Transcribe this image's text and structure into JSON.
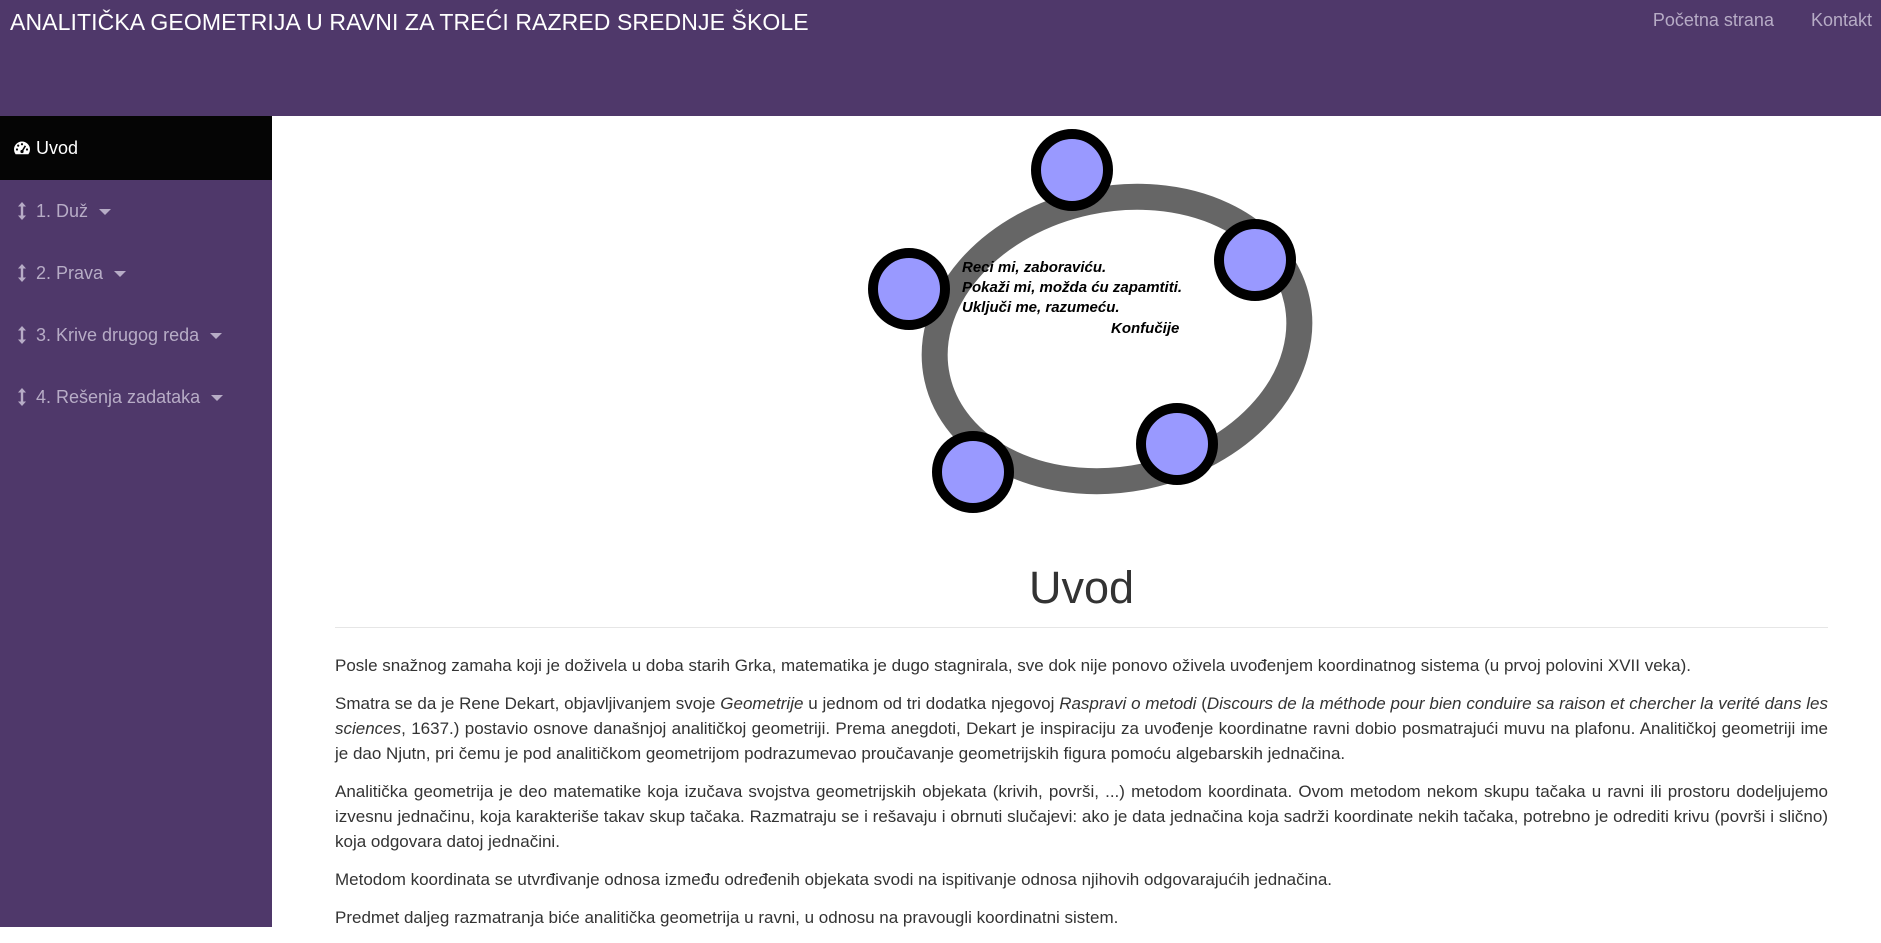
{
  "header": {
    "title": "ANALITIČKA GEOMETRIJA U RAVNI ZA TREĆI RAZRED SREDNJE ŠKOLE",
    "nav": [
      {
        "label": "Početna strana"
      },
      {
        "label": "Kontakt"
      }
    ],
    "background_color": "#4f386a",
    "nav_color": "#b7acc6"
  },
  "sidebar": {
    "background_color": "#4f386a",
    "active_background_color": "#050505",
    "items": [
      {
        "label": "Uvod",
        "icon": "dashboard-icon",
        "active": true
      },
      {
        "label": "1. Duž",
        "icon": "vertical-arrows-icon",
        "has_dropdown": true
      },
      {
        "label": "2. Prava",
        "icon": "vertical-arrows-icon",
        "has_dropdown": true
      },
      {
        "label": "3. Krive drugog reda",
        "icon": "vertical-arrows-icon",
        "has_dropdown": true
      },
      {
        "label": "4. Rešenja zadataka",
        "icon": "vertical-arrows-icon",
        "has_dropdown": true
      }
    ]
  },
  "logo": {
    "quote": [
      "Reci mi, zaboraviću.",
      "Pokaži mi, možda ću zapamtiti.",
      "Uključi me, razumeću.",
      "Konfučije"
    ],
    "ring_color": "#666666",
    "point_fill_color": "#9999ff",
    "point_stroke_color": "#000000"
  },
  "main": {
    "title": "Uvod",
    "paragraphs": [
      {
        "text": "Posle snažnog zamaha koji je doživela u doba starih Grka, matematika je dugo stagnirala, sve dok nije ponovo oživela uvođenjem koordinatnog sistema (u prvoj polovini XVII veka)."
      },
      {
        "part1": "Smatra se da je Rene Dekart, objavljivanjem svoje ",
        "em1": "Geometrije",
        "part2": " u jednom od tri dodatka njegovoj ",
        "em2": "Raspravi o metodi",
        "part3": " (",
        "em3": "Discours de la méthode pour bien conduire sa raison et chercher la verité dans les sciences",
        "part4": ", 1637.) postavio osnove današnjoj analitičkoj geometriji. Prema anegdoti, Dekart je inspiraciju za uvođenje koordinatne ravni dobio posmatrajući muvu na plafonu. Analitičkoj geometriji ime je dao Njutn, pri čemu je pod analitičkom geometrijom podrazumevao proučavanje geometrijskih figura pomoću algebarskih jednačina."
      },
      {
        "text": "Analitička geometrija je deo matematike koja izučava svojstva geometrijskih objekata (krivih, površi, ...) metodom koordinata. Ovom metodom nekom skupu tačaka u ravni ili prostoru dodeljujemo izvesnu jednačinu, koja karakteriše takav skup tačaka. Razmatraju se i rešavaju i obrnuti slučajevi: ako je data jednačina koja sadrži koordinate nekih tačaka, potrebno je odrediti krivu (površi i slično) koja odgovara datoj jednačini."
      },
      {
        "text": "Metodom koordinata se utvrđivanje odnosa između određenih objekata svodi na ispitivanje odnosa njihovih odgovarajućih jednačina."
      },
      {
        "text": "Predmet daljeg razmatranja biće analitička geometrija u ravni, u odnosu na pravougli koordinatni sistem."
      }
    ]
  }
}
